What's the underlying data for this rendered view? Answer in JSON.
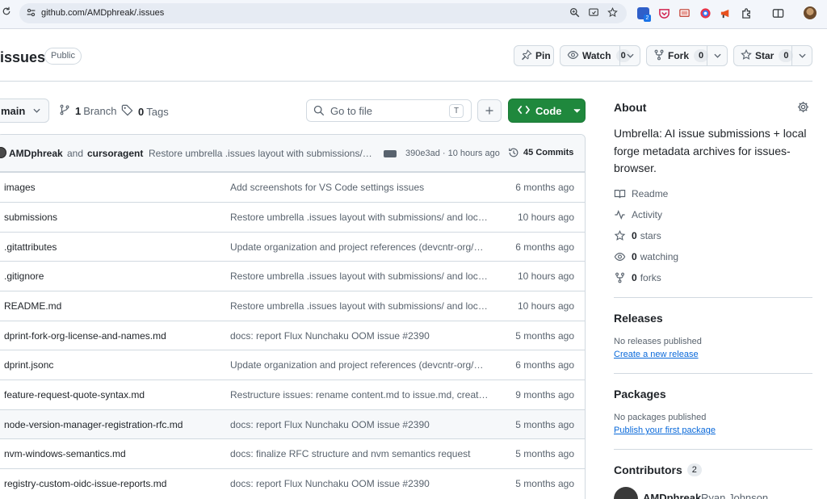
{
  "browser": {
    "url": "github.com/AMDphreak/.issues",
    "extension_badge": "2"
  },
  "header": {
    "repo_name": "issues",
    "visibility": "Public",
    "pin_label": "Pin",
    "watch_label": "Watch",
    "watch_count": "0",
    "fork_label": "Fork",
    "fork_count": "0",
    "star_label": "Star",
    "star_count": "0"
  },
  "toolbar": {
    "branch": "main",
    "branches_count": "1",
    "branches_label": "Branch",
    "tags_count": "0",
    "tags_label": "Tags",
    "goto_placeholder": "Go to file",
    "goto_shortcut": "T",
    "code_label": "Code"
  },
  "latest_commit": {
    "author": "AMDphreak",
    "and": "and",
    "coauthor": "cursoragent",
    "message": "Restore umbrella .issues layout with submissions/ and local forge metadata",
    "hash_time": "390e3ad · 10 hours ago",
    "commits_count": "45",
    "commits_label": "Commits"
  },
  "files": [
    {
      "name": "images",
      "message": "Add screenshots for VS Code settings issues",
      "age": "6 months ago"
    },
    {
      "name": "submissions",
      "message": "Restore umbrella .issues layout with submissions/ and local forge metadata",
      "age": "10 hours ago"
    },
    {
      "name": ".gitattributes",
      "message": "Update organization and project references (devcntr-org/devcntr)",
      "age": "6 months ago"
    },
    {
      "name": ".gitignore",
      "message": "Restore umbrella .issues layout with submissions/ and local forge metadata",
      "age": "10 hours ago"
    },
    {
      "name": "README.md",
      "message": "Restore umbrella .issues layout with submissions/ and local forge metadata",
      "age": "10 hours ago"
    },
    {
      "name": "dprint-fork-org-license-and-names.md",
      "message": "docs: report Flux Nunchaku OOM issue #2390",
      "age": "5 months ago"
    },
    {
      "name": "dprint.jsonc",
      "message": "Update organization and project references (devcntr-org/devcntr)",
      "age": "6 months ago"
    },
    {
      "name": "feature-request-quote-syntax.md",
      "message": "Restructure issues: rename content.md to issue.md, create folders",
      "age": "9 months ago"
    },
    {
      "name": "node-version-manager-registration-rfc.md",
      "message": "docs: report Flux Nunchaku OOM issue #2390",
      "age": "5 months ago"
    },
    {
      "name": "nvm-windows-semantics.md",
      "message": "docs: finalize RFC structure and nvm semantics request",
      "age": "5 months ago"
    },
    {
      "name": "registry-custom-oidc-issue-reports.md",
      "message": "docs: report Flux Nunchaku OOM issue #2390",
      "age": "5 months ago"
    }
  ],
  "sidebar": {
    "about_title": "About",
    "description": "Umbrella: AI issue submissions + local forge metadata archives for issues-browser.",
    "readme": "Readme",
    "activity": "Activity",
    "stars_count": "0",
    "stars_label": "stars",
    "watching_count": "0",
    "watching_label": "watching",
    "forks_count": "0",
    "forks_label": "forks",
    "releases_title": "Releases",
    "releases_note": "No releases published",
    "releases_link": "Create a new release",
    "packages_title": "Packages",
    "packages_note": "No packages published",
    "packages_link": "Publish your first package",
    "contributors_title": "Contributors",
    "contributors_count": "2",
    "contributor_login": "AMDphreak",
    "contributor_name": "Ryan Johnson"
  },
  "colors": {
    "accent_green": "#1f883d",
    "link_blue": "#0969da",
    "border": "#d1d9e0",
    "muted_text": "#59636e"
  }
}
